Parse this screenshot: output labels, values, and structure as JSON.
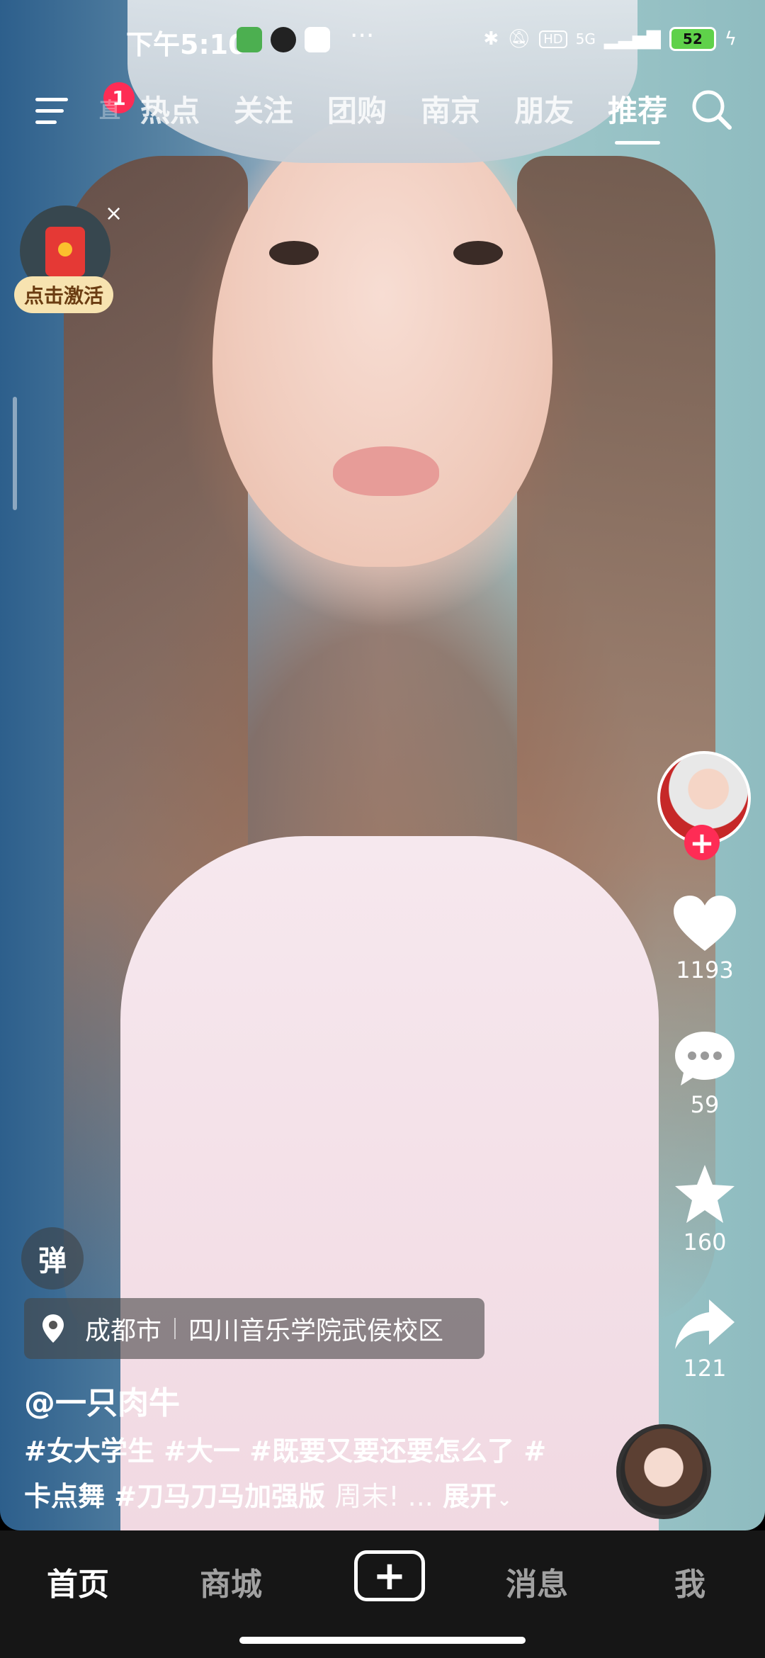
{
  "status_bar": {
    "time": "下午5:10",
    "more": "···",
    "network": "5G",
    "hd": "HD",
    "battery": "52"
  },
  "top_nav": {
    "menu_badge": "1",
    "tabs": [
      {
        "label": "热点"
      },
      {
        "label": "关注"
      },
      {
        "label": "团购"
      },
      {
        "label": "南京"
      },
      {
        "label": "朋友"
      },
      {
        "label": "推荐",
        "active": true
      }
    ],
    "partial_tab": "直"
  },
  "red_packet": {
    "label": "点击激活",
    "close": "×"
  },
  "actions": {
    "follow_plus": "+",
    "likes": "1193",
    "comments": "59",
    "favorites": "160",
    "shares": "121"
  },
  "video_info": {
    "danmu": "弹",
    "location_city": "成都市",
    "location_place": "四川音乐学院武侯校区",
    "author": "@一只肉牛",
    "caption_line1": "#女大学生 #大一 #既要又要还要怎么了 #",
    "caption_line2_tags": "卡点舞 #刀马刀马加强版",
    "caption_line2_text": "周末! ...",
    "expand": "展开"
  },
  "bottom_nav": {
    "home": "首页",
    "mall": "商城",
    "plus": "+",
    "messages": "消息",
    "me": "我"
  },
  "colors": {
    "accent": "#fe2c55",
    "nav_bg": "#161616"
  }
}
